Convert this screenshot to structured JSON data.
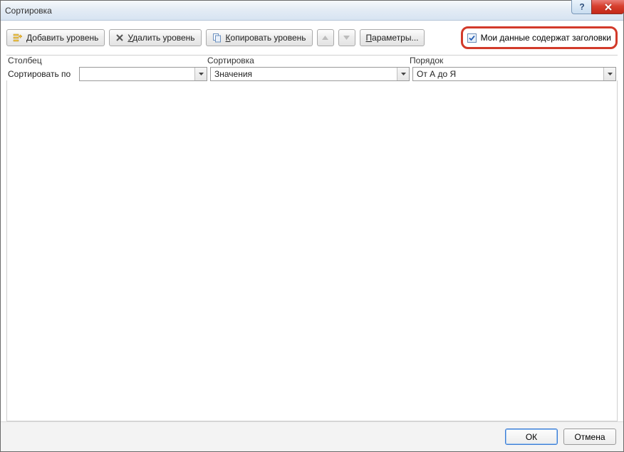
{
  "title": "Сортировка",
  "toolbar": {
    "add_prefix": "Д",
    "add_rest": "обавить уровень",
    "delete_prefix": "У",
    "delete_rest": "далить уровень",
    "copy_prefix": "К",
    "copy_rest": "опировать уровень",
    "options_prefix": "П",
    "options_rest": "араметры..."
  },
  "headers_checkbox": {
    "prefix": "Мои данные содержат ",
    "u": "з",
    "rest": "аголовки",
    "checked": true
  },
  "columns": {
    "col1": "Столбец",
    "col2": "Сортировка",
    "col3": "Порядок"
  },
  "row": {
    "label": "Сортировать по",
    "column_value": "",
    "sort_on_value": "Значения",
    "order_value": "От А до Я"
  },
  "buttons": {
    "ok": "ОК",
    "cancel": "Отмена"
  }
}
